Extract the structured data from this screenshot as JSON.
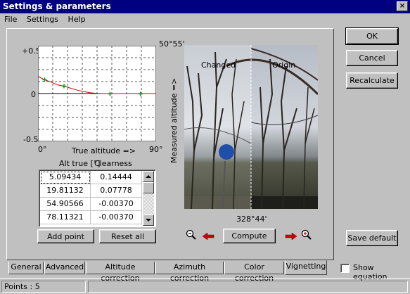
{
  "window": {
    "title": "Settings & parameters",
    "close_glyph": "×"
  },
  "menu": {
    "file": "File",
    "settings": "Settings",
    "help": "Help"
  },
  "chart_data": {
    "type": "line",
    "title": "",
    "xlabel": "True altitude =>",
    "ylabel": "",
    "xlim": [
      0,
      90
    ],
    "ylim": [
      -0.5,
      0.5
    ],
    "x_ticks": [
      "0°",
      "90°"
    ],
    "y_ticks": [
      "+0.5",
      "0",
      "-0.5"
    ],
    "grid": true,
    "series": [
      {
        "x": [
          0,
          5,
          10,
          15,
          20,
          25,
          30,
          35,
          40,
          45,
          50,
          55,
          60,
          65,
          70,
          75,
          80,
          85,
          90
        ],
        "y": [
          0.18,
          0.14444,
          0.12,
          0.09,
          0.077,
          0.055,
          0.035,
          0.02,
          0.008,
          0.002,
          0,
          0,
          0,
          0,
          0,
          0,
          0,
          0,
          0
        ],
        "color": "#cc0000"
      }
    ],
    "points": [
      {
        "x": 5.09434,
        "y": 0.14444
      },
      {
        "x": 19.81132,
        "y": 0.07778
      },
      {
        "x": 54.90566,
        "y": -0.0037
      },
      {
        "x": 78.11321,
        "y": -0.0037
      }
    ]
  },
  "table": {
    "headers": [
      "Alt true [°]",
      "Clearness"
    ],
    "rows": [
      [
        "5.09434",
        "0.14444"
      ],
      [
        "19.81132",
        "0.07778"
      ],
      [
        "54.90566",
        "-0.00370"
      ],
      [
        "78.11321",
        "-0.00370"
      ]
    ]
  },
  "buttons": {
    "add_point": "Add point",
    "reset_all": "Reset all",
    "compute": "Compute",
    "ok": "OK",
    "cancel": "Cancel",
    "recalculate": "Recalculate",
    "save_default": "Save default"
  },
  "photo": {
    "top_label": "50°55'",
    "side_label": "Measured altitude =>",
    "changed_label": "Changed",
    "origin_label": "Origin",
    "bottom_label": "328°44'"
  },
  "tabs": [
    "General",
    "Advanced",
    "Altitude correction",
    "Azimuth correction",
    "Color correction",
    "Vignetting"
  ],
  "active_tab": "Vignetting",
  "show_equation": {
    "label": "Show equation",
    "checked": false
  },
  "status": {
    "points": "Points : 5",
    "cell2": ""
  },
  "colors": {
    "title_bg": "#000080",
    "curve": "#cc0000",
    "marker": "#00a000",
    "arrow": "#cc0000"
  }
}
